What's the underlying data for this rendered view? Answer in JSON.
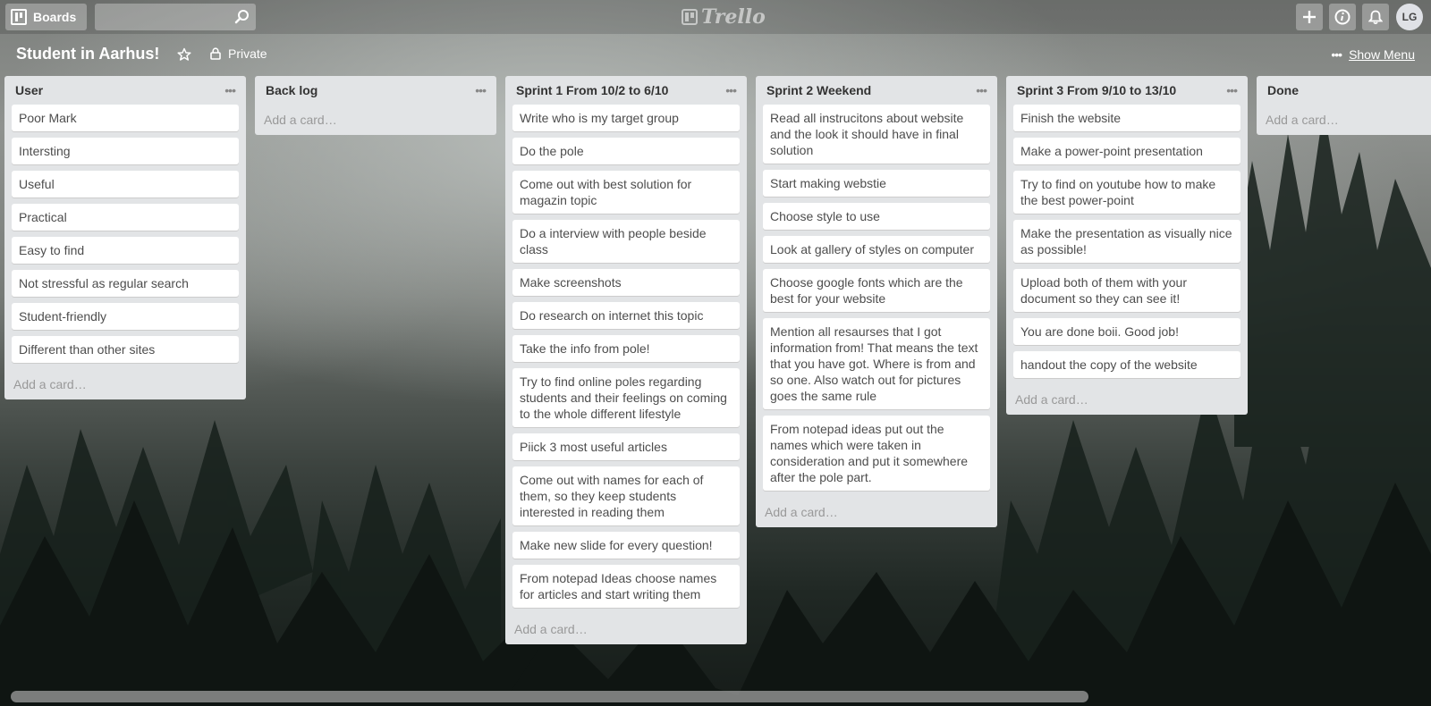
{
  "header": {
    "boards_label": "Boards",
    "search_placeholder": "",
    "logo_text": "Trello",
    "avatar_initials": "LG",
    "icons": [
      "boards-icon",
      "search-icon",
      "plus-icon",
      "info-icon",
      "bell-icon"
    ]
  },
  "board": {
    "title": "Student in Aarhus!",
    "privacy": "Private",
    "show_menu": "Show Menu"
  },
  "lists": [
    {
      "title": "User",
      "cards": [
        "Poor Mark",
        "Intersting",
        "Useful",
        "Practical",
        "Easy to find",
        "Not stressful as regular search",
        "Student-friendly",
        "Different than other sites"
      ],
      "add_card": "Add a card…"
    },
    {
      "title": "Back log",
      "cards": [],
      "add_card": "Add a card…"
    },
    {
      "title": "Sprint 1 From 10/2 to 6/10",
      "cards": [
        "Write who is my target group",
        "Do the pole",
        "Come out with best solution for magazin topic",
        "Do a interview with people beside class",
        "Make screenshots",
        "Do research on internet this topic",
        "Take the info from pole!",
        "Try to find online poles regarding students and their feelings on coming to the whole different lifestyle",
        "Piick 3 most useful articles",
        "Come out with names for each of them, so they keep students interested in reading them",
        "Make new slide for every question!",
        "From notepad Ideas choose names for articles and start writing them"
      ],
      "add_card": "Add a card…"
    },
    {
      "title": "Sprint 2 Weekend",
      "cards": [
        "Read all instrucitons about website and the look it should have in final solution",
        "Start making webstie",
        "Choose style to use",
        "Look at gallery of styles on computer",
        "Choose google fonts which are the best for your website",
        "Mention all resaurses that I got information from! That means the text that you have got. Where is from and so one. Also watch out for pictures goes the same rule",
        "From notepad ideas put out the names which were taken in consideration and put it somewhere after the pole part."
      ],
      "add_card": "Add a card…"
    },
    {
      "title": "Sprint 3 From 9/10 to 13/10",
      "cards": [
        "Finish the website",
        "Make a power-point presentation",
        "Try to find on youtube how to make the best power-point",
        "Make the presentation as visually nice as possible!",
        "Upload both of them with your document so they can see it!",
        "You are done boii. Good job!",
        "handout the copy of the website"
      ],
      "add_card": "Add a card…"
    },
    {
      "title": "Done",
      "cards": [],
      "add_card": "Add a card…"
    }
  ]
}
